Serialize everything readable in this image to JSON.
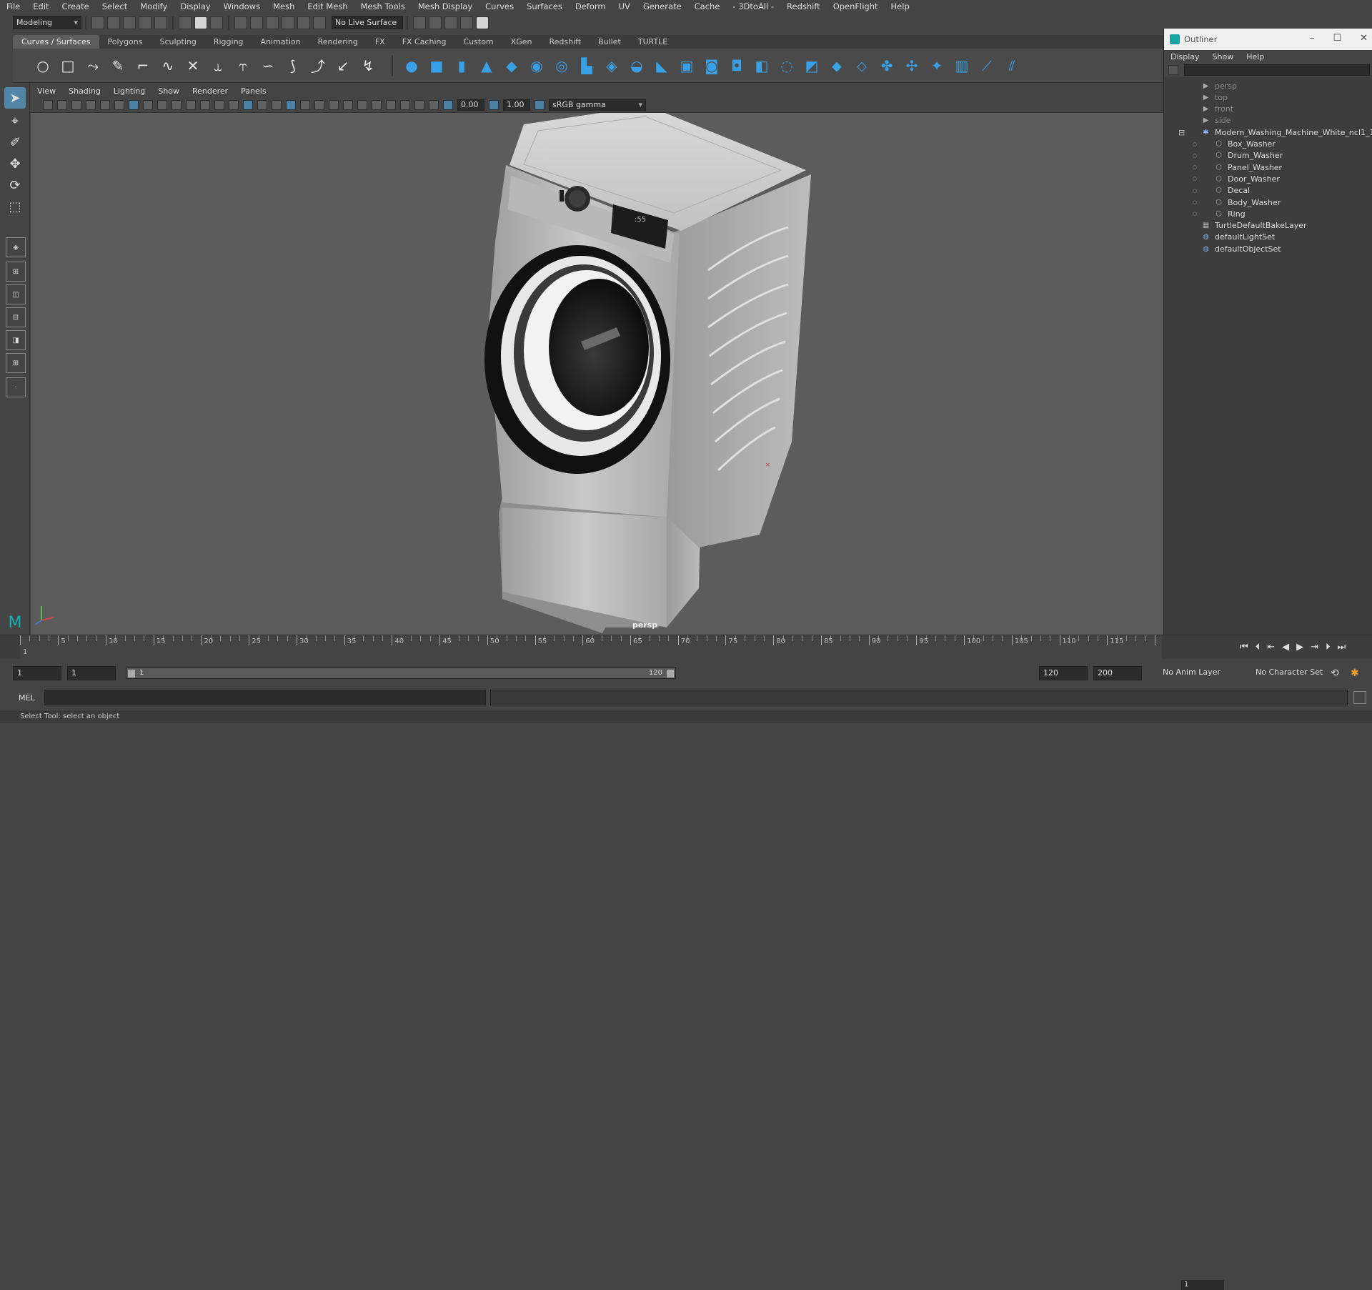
{
  "menubar": [
    "File",
    "Edit",
    "Create",
    "Select",
    "Modify",
    "Display",
    "Windows",
    "Mesh",
    "Edit Mesh",
    "Mesh Tools",
    "Mesh Display",
    "Curves",
    "Surfaces",
    "Deform",
    "UV",
    "Generate",
    "Cache",
    "- 3DtoAll -",
    "Redshift",
    "OpenFlight",
    "Help"
  ],
  "statusline": {
    "mode": "Modeling",
    "live_surface": "No Live Surface"
  },
  "shelf_tabs": [
    "Curves / Surfaces",
    "Polygons",
    "Sculpting",
    "Rigging",
    "Animation",
    "Rendering",
    "FX",
    "FX Caching",
    "Custom",
    "XGen",
    "Redshift",
    "Bullet",
    "TURTLE"
  ],
  "active_shelf_tab": "Curves / Surfaces",
  "panel_menu": [
    "View",
    "Shading",
    "Lighting",
    "Show",
    "Renderer",
    "Panels"
  ],
  "panel_toolbar": {
    "exposure": "0.00",
    "gamma": "1.00",
    "color_space": "sRGB gamma"
  },
  "viewport": {
    "camera_label": "persp"
  },
  "outliner": {
    "title": "Outliner",
    "menu": [
      "Display",
      "Show",
      "Help"
    ],
    "items": [
      {
        "label": "persp",
        "dim": true,
        "icon": "camera-icon",
        "indent": 0
      },
      {
        "label": "top",
        "dim": true,
        "icon": "camera-icon",
        "indent": 0
      },
      {
        "label": "front",
        "dim": true,
        "icon": "camera-icon",
        "indent": 0
      },
      {
        "label": "side",
        "dim": true,
        "icon": "camera-icon",
        "indent": 0
      },
      {
        "label": "Modern_Washing_Machine_White_ncl1_1",
        "dim": false,
        "icon": "group-icon",
        "indent": 0
      },
      {
        "label": "Box_Washer",
        "dim": false,
        "icon": "mesh-icon",
        "indent": 1
      },
      {
        "label": "Drum_Washer",
        "dim": false,
        "icon": "mesh-icon",
        "indent": 1
      },
      {
        "label": "Panel_Washer",
        "dim": false,
        "icon": "mesh-icon",
        "indent": 1
      },
      {
        "label": "Door_Washer",
        "dim": false,
        "icon": "mesh-icon",
        "indent": 1
      },
      {
        "label": "Decal",
        "dim": false,
        "icon": "mesh-icon",
        "indent": 1
      },
      {
        "label": "Body_Washer",
        "dim": false,
        "icon": "mesh-icon",
        "indent": 1
      },
      {
        "label": "Ring",
        "dim": false,
        "icon": "mesh-icon",
        "indent": 1
      },
      {
        "label": "TurtleDefaultBakeLayer",
        "dim": false,
        "icon": "bake-layer-icon",
        "indent": 0
      },
      {
        "label": "defaultLightSet",
        "dim": false,
        "icon": "set-icon",
        "indent": 0
      },
      {
        "label": "defaultObjectSet",
        "dim": false,
        "icon": "set-icon",
        "indent": 0
      }
    ]
  },
  "timeline": {
    "labels": [
      "1",
      "5",
      "10",
      "15",
      "20",
      "25",
      "30",
      "35",
      "40",
      "45",
      "50",
      "55",
      "60",
      "65",
      "70",
      "75",
      "80",
      "85",
      "90",
      "95",
      "100",
      "105",
      "110",
      "115",
      "1"
    ],
    "current_frame": "1"
  },
  "range": {
    "start": "1",
    "anim_start": "1",
    "slider_start": "1",
    "slider_end": "120",
    "end": "120",
    "anim_end": "200",
    "anim_layer": "No Anim Layer",
    "character_set": "No Character Set"
  },
  "cmdline": {
    "mel_label": "MEL"
  },
  "helpline": "Select Tool: select an object"
}
